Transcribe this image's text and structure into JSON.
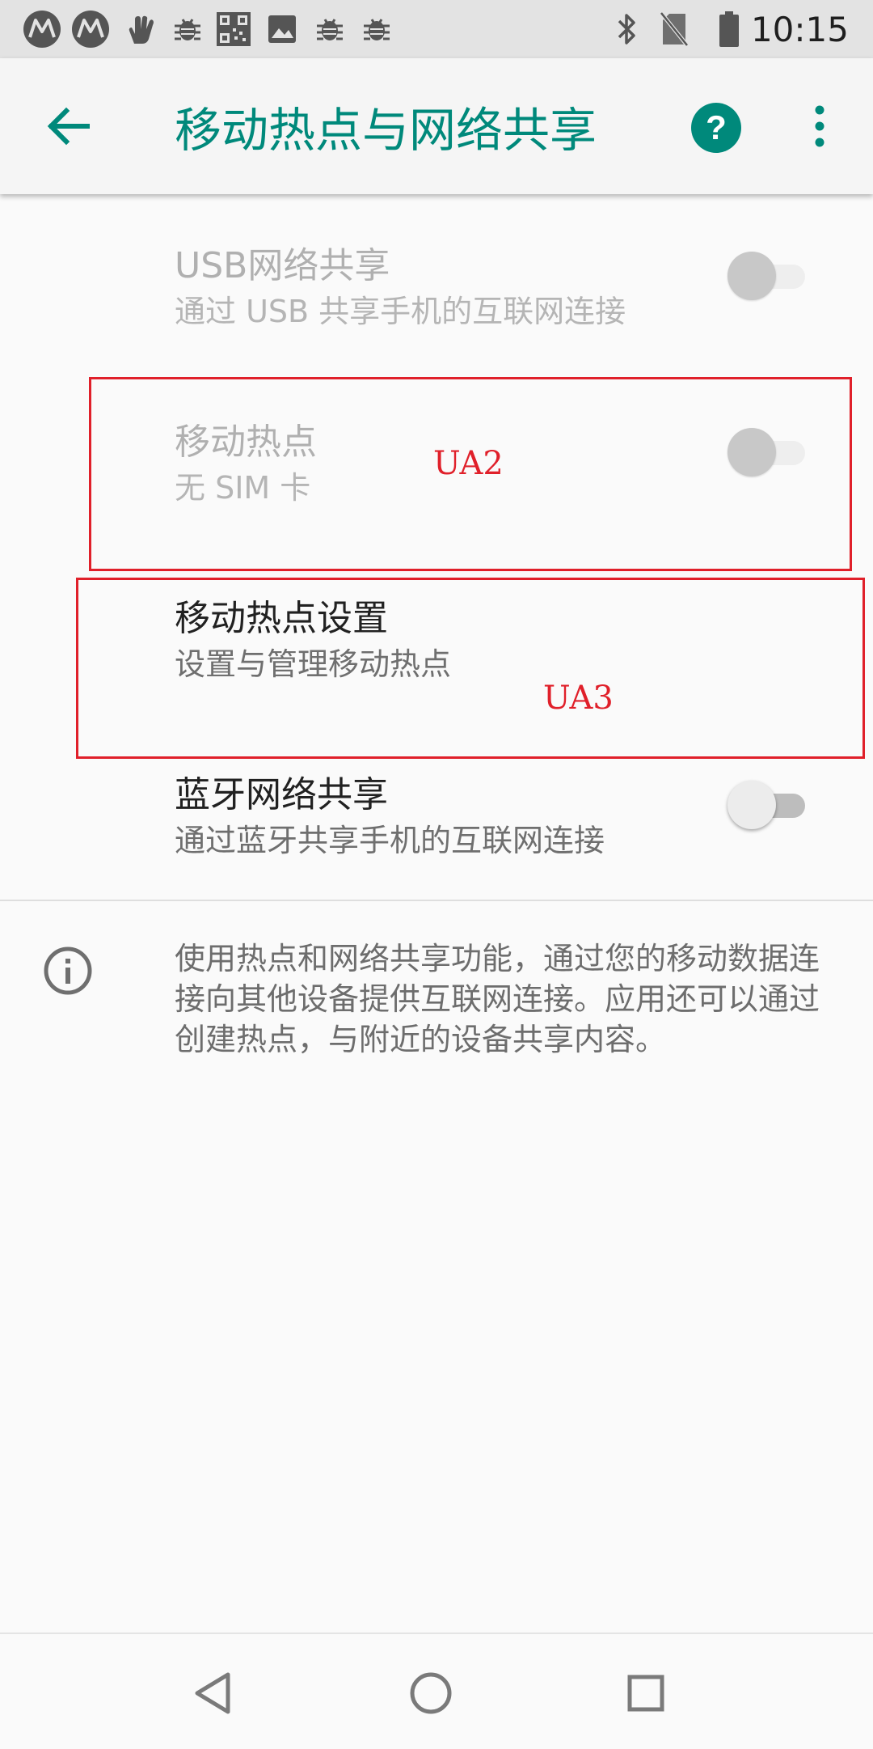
{
  "status_bar": {
    "time": "10:15",
    "left_icons": [
      "motorola-icon",
      "motorola-icon",
      "gesture-icon",
      "bug-icon",
      "qr-code-icon",
      "image-icon",
      "bug-icon",
      "bug-icon"
    ],
    "right_icons": [
      "bluetooth-icon",
      "no-sim-icon",
      "battery-icon"
    ]
  },
  "app_bar": {
    "title": "移动热点与网络共享",
    "accent_color": "#00897b"
  },
  "items": [
    {
      "title": "USB网络共享",
      "summary": "通过 USB 共享手机的互联网连接",
      "enabled": false,
      "checked": false
    },
    {
      "title": "移动热点",
      "summary": "无 SIM 卡",
      "enabled": false,
      "checked": false
    },
    {
      "title": "移动热点设置",
      "summary": "设置与管理移动热点"
    },
    {
      "title": "蓝牙网络共享",
      "summary": "通过蓝牙共享手机的互联网连接",
      "enabled": true,
      "checked": false
    }
  ],
  "info": {
    "text": "使用热点和网络共享功能，通过您的移动数据连接向其他设备提供互联网连接。应用还可以通过创建热点，与附近的设备共享内容。"
  },
  "annotations": {
    "ua2": "UA2",
    "ua3": "UA3",
    "color": "#e0202a"
  }
}
